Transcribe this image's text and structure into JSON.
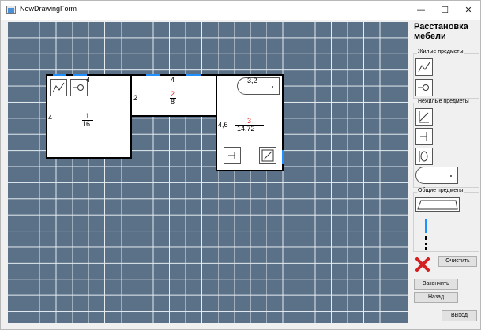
{
  "window": {
    "title": "NewDrawingForm",
    "minimize": "—",
    "maximize": "☐",
    "close": "✕"
  },
  "canvas": {
    "rooms": [
      {
        "number": "1",
        "area": "16",
        "height_label": "4",
        "width_label": "4"
      },
      {
        "number": "2",
        "area": "8",
        "height_label": "2",
        "width_label": "4"
      },
      {
        "number": "3",
        "area": "14,72",
        "height_label": "4,6",
        "width_label": "3,2"
      }
    ]
  },
  "sidebar": {
    "title": "Расстановка мебели",
    "groups": [
      {
        "label": "Жилые предметы",
        "items": [
          "sofa-icon",
          "table-chair-icon"
        ]
      },
      {
        "label": "Нежилые предметы",
        "items": [
          "shelf-icon",
          "cabinet-icon",
          "sink-icon",
          "bathtub-icon"
        ]
      },
      {
        "label": "Общие предметы",
        "items": [
          "wall-icon",
          "window-icon",
          "door-icon"
        ]
      }
    ],
    "clear_button": "Очистить",
    "finish_button": "Закончить",
    "back_button": "Назад",
    "exit_button": "Выход"
  },
  "colors": {
    "canvas_bg": "#5b7187",
    "grid_line": "#e6ecf2",
    "accent_red": "#e02020",
    "window_blue": "#1e90ff"
  }
}
